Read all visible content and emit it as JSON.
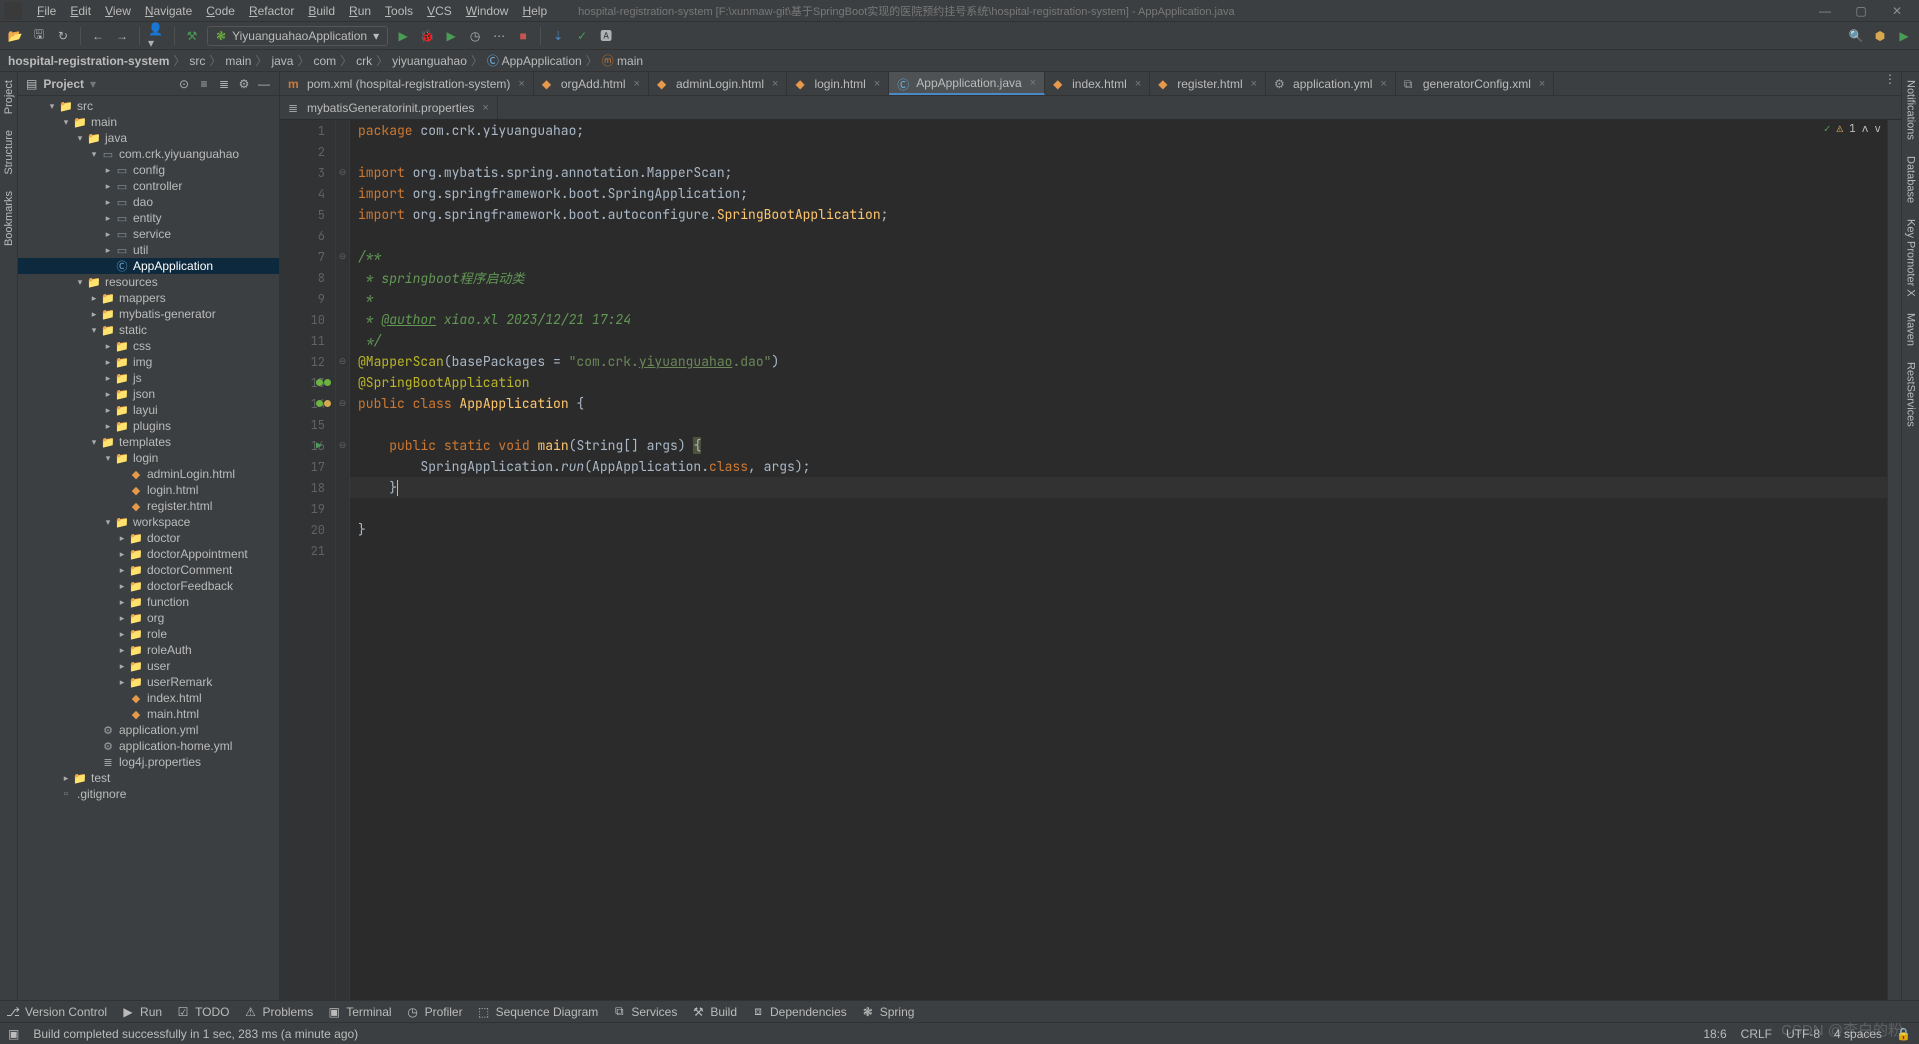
{
  "title": "hospital-registration-system [F:\\xunmaw-git\\基于SpringBoot实现的医院预约挂号系统\\hospital-registration-system] - AppApplication.java",
  "menu": [
    "File",
    "Edit",
    "View",
    "Navigate",
    "Code",
    "Refactor",
    "Build",
    "Run",
    "Tools",
    "VCS",
    "Window",
    "Help"
  ],
  "runConfig": "YiyuanguahaoApplication",
  "breadcrumb": [
    "hospital-registration-system",
    "src",
    "main",
    "java",
    "com",
    "crk",
    "yiyuanguahao",
    "AppApplication",
    "main"
  ],
  "projectPanel": {
    "title": "Project"
  },
  "tree": [
    {
      "d": 2,
      "a": "v",
      "i": "folder-src",
      "t": "src"
    },
    {
      "d": 3,
      "a": "v",
      "i": "folder-src",
      "t": "main"
    },
    {
      "d": 4,
      "a": "v",
      "i": "folder-src",
      "t": "java"
    },
    {
      "d": 5,
      "a": "v",
      "i": "pkg",
      "t": "com.crk.yiyuanguahao"
    },
    {
      "d": 6,
      "a": ">",
      "i": "pkg",
      "t": "config"
    },
    {
      "d": 6,
      "a": ">",
      "i": "pkg",
      "t": "controller"
    },
    {
      "d": 6,
      "a": ">",
      "i": "pkg",
      "t": "dao"
    },
    {
      "d": 6,
      "a": ">",
      "i": "pkg",
      "t": "entity"
    },
    {
      "d": 6,
      "a": ">",
      "i": "pkg",
      "t": "service"
    },
    {
      "d": 6,
      "a": ">",
      "i": "pkg",
      "t": "util"
    },
    {
      "d": 6,
      "a": "",
      "i": "java",
      "t": "AppApplication",
      "sel": true
    },
    {
      "d": 4,
      "a": "v",
      "i": "folder",
      "t": "resources"
    },
    {
      "d": 5,
      "a": ">",
      "i": "folder",
      "t": "mappers"
    },
    {
      "d": 5,
      "a": ">",
      "i": "folder",
      "t": "mybatis-generator"
    },
    {
      "d": 5,
      "a": "v",
      "i": "folder",
      "t": "static"
    },
    {
      "d": 6,
      "a": ">",
      "i": "folder",
      "t": "css"
    },
    {
      "d": 6,
      "a": ">",
      "i": "folder",
      "t": "img"
    },
    {
      "d": 6,
      "a": ">",
      "i": "folder",
      "t": "js"
    },
    {
      "d": 6,
      "a": ">",
      "i": "folder",
      "t": "json"
    },
    {
      "d": 6,
      "a": ">",
      "i": "folder",
      "t": "layui"
    },
    {
      "d": 6,
      "a": ">",
      "i": "folder",
      "t": "plugins"
    },
    {
      "d": 5,
      "a": "v",
      "i": "folder",
      "t": "templates"
    },
    {
      "d": 6,
      "a": "v",
      "i": "folder",
      "t": "login"
    },
    {
      "d": 7,
      "a": "",
      "i": "html",
      "t": "adminLogin.html"
    },
    {
      "d": 7,
      "a": "",
      "i": "html",
      "t": "login.html"
    },
    {
      "d": 7,
      "a": "",
      "i": "html",
      "t": "register.html"
    },
    {
      "d": 6,
      "a": "v",
      "i": "folder",
      "t": "workspace"
    },
    {
      "d": 7,
      "a": ">",
      "i": "folder",
      "t": "doctor"
    },
    {
      "d": 7,
      "a": ">",
      "i": "folder",
      "t": "doctorAppointment"
    },
    {
      "d": 7,
      "a": ">",
      "i": "folder",
      "t": "doctorComment"
    },
    {
      "d": 7,
      "a": ">",
      "i": "folder",
      "t": "doctorFeedback"
    },
    {
      "d": 7,
      "a": ">",
      "i": "folder",
      "t": "function"
    },
    {
      "d": 7,
      "a": ">",
      "i": "folder",
      "t": "org"
    },
    {
      "d": 7,
      "a": ">",
      "i": "folder",
      "t": "role"
    },
    {
      "d": 7,
      "a": ">",
      "i": "folder",
      "t": "roleAuth"
    },
    {
      "d": 7,
      "a": ">",
      "i": "folder",
      "t": "user"
    },
    {
      "d": 7,
      "a": ">",
      "i": "folder",
      "t": "userRemark"
    },
    {
      "d": 7,
      "a": "",
      "i": "html",
      "t": "index.html"
    },
    {
      "d": 7,
      "a": "",
      "i": "html",
      "t": "main.html"
    },
    {
      "d": 5,
      "a": "",
      "i": "yml",
      "t": "application.yml"
    },
    {
      "d": 5,
      "a": "",
      "i": "yml",
      "t": "application-home.yml"
    },
    {
      "d": 5,
      "a": "",
      "i": "prop",
      "t": "log4j.properties"
    },
    {
      "d": 3,
      "a": ">",
      "i": "folder",
      "t": "test"
    },
    {
      "d": 2,
      "a": "",
      "i": "file",
      "t": ".gitignore"
    }
  ],
  "tabs1": [
    {
      "ic": "m",
      "t": "pom.xml (hospital-registration-system)"
    },
    {
      "ic": "h",
      "t": "orgAdd.html"
    },
    {
      "ic": "h",
      "t": "adminLogin.html"
    },
    {
      "ic": "h",
      "t": "login.html"
    },
    {
      "ic": "c",
      "t": "AppApplication.java",
      "active": true
    },
    {
      "ic": "h",
      "t": "index.html"
    },
    {
      "ic": "h",
      "t": "register.html"
    },
    {
      "ic": "y",
      "t": "application.yml"
    },
    {
      "ic": "x",
      "t": "generatorConfig.xml"
    }
  ],
  "tabs2": [
    {
      "ic": "p",
      "t": "mybatisGeneratorinit.properties"
    }
  ],
  "inspection": {
    "warnings": "1"
  },
  "code": {
    "l1_kw": "package",
    "l1_b": " com.crk.yiyuanguahao;",
    "l3_kw": "import",
    "l3_b": " org.mybatis.spring.annotation.MapperScan;",
    "l4_kw": "import",
    "l4_b": " org.springframework.boot.SpringApplication;",
    "l5_kw": "import",
    "l5_b": " org.springframework.boot.autoconfigure.",
    "l5_c": "SpringBootApplication",
    "l5_d": ";",
    "l7": "/**",
    "l8": " * springboot程序启动类",
    "l9": " *",
    "l10a": " * ",
    "l10b": "@author",
    "l10c": " xiao.xl 2023/12/21 17:24",
    "l11": " */",
    "l12a": "@MapperScan",
    "l12b": "(basePackages = ",
    "l12c": "\"com.crk.",
    "l12d": "yiyuanguahao",
    "l12e": ".dao\"",
    "l12f": ")",
    "l13": "@SpringBootApplication",
    "l14a": "public",
    "l14b": " class ",
    "l14c": "AppApplication",
    "l14d": " {",
    "l16a": "    public",
    "l16b": " static",
    "l16c": " void ",
    "l16d": "main",
    "l16e": "(String[] args) ",
    "l16f": "{",
    "l17a": "        SpringApplication.",
    "l17b": "run",
    "l17c": "(AppApplication.",
    "l17d": "class",
    "l17e": ", args);",
    "l18": "    }",
    "l20": "}"
  },
  "bottomTabs": [
    "Version Control",
    "Run",
    "TODO",
    "Problems",
    "Terminal",
    "Profiler",
    "Sequence Diagram",
    "Services",
    "Build",
    "Dependencies",
    "Spring"
  ],
  "status": {
    "msg": "Build completed successfully in 1 sec, 283 ms (a minute ago)",
    "pos": "18:6",
    "eol": "CRLF",
    "enc": "UTF-8",
    "indent": "4 spaces"
  },
  "watermark": "CSDN @李白的粉",
  "leftTabs": [
    "Project",
    "Structure",
    "Bookmarks"
  ],
  "rightTabs": [
    "Notifications",
    "Database",
    "Key Promoter X",
    "Maven",
    "RestServices"
  ]
}
